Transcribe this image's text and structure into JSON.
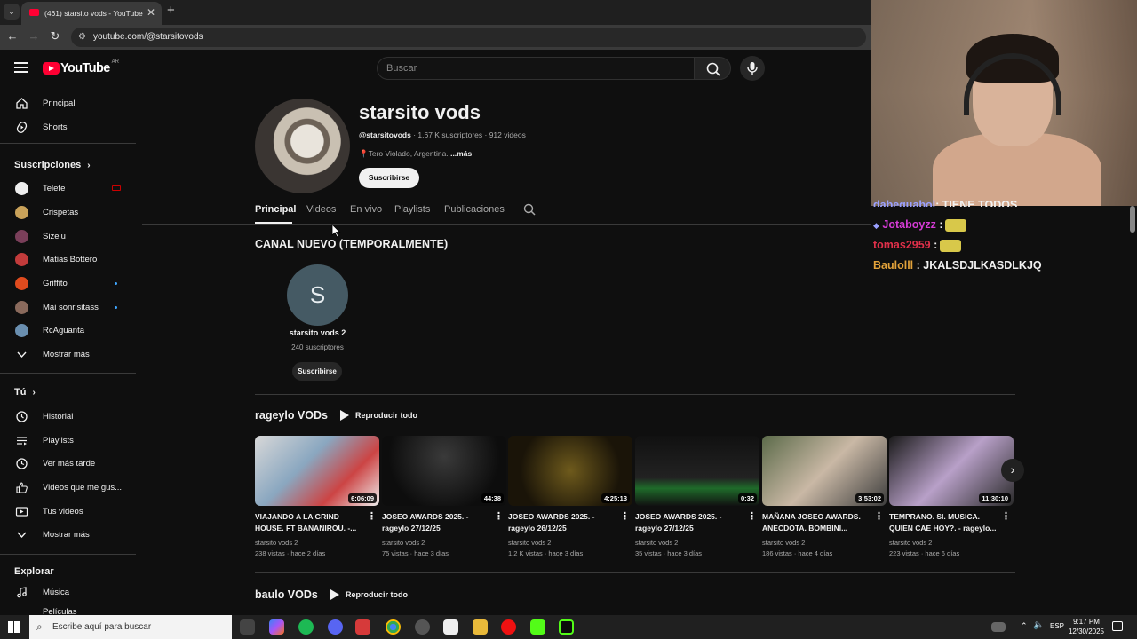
{
  "browser": {
    "tab_count_title": "(461) starsito vods - YouTube",
    "url": "youtube.com/@starsitovods"
  },
  "masthead": {
    "country": "AR",
    "logo_text": "YouTube",
    "search_placeholder": "Buscar"
  },
  "sidebar": {
    "main": [
      {
        "label": "Principal",
        "icon": "home-icon"
      },
      {
        "label": "Shorts",
        "icon": "shorts-icon"
      }
    ],
    "subs_title": "Suscripciones",
    "subs": [
      {
        "label": "Telefe",
        "color": "#1a8f3c",
        "live": true
      },
      {
        "label": "Crispetas",
        "color": "#c9a25a",
        "dot": false
      },
      {
        "label": "Sizelu",
        "color": "#7a3f5a",
        "dot": false
      },
      {
        "label": "Matias Bottero",
        "color": "#c23b3b",
        "dot": false
      },
      {
        "label": "Griffito",
        "color": "#e04b1e",
        "dot": true
      },
      {
        "label": "Mai sonrisitass",
        "color": "#8a6a5c",
        "dot": true
      },
      {
        "label": "RcAguanta",
        "color": "#6a8fb0",
        "dot": false
      }
    ],
    "show_more": "Mostrar más",
    "you_title": "Tú",
    "you": [
      {
        "label": "Historial",
        "icon": "history-icon"
      },
      {
        "label": "Playlists",
        "icon": "playlists-icon"
      },
      {
        "label": "Ver más tarde",
        "icon": "watch-later-icon"
      },
      {
        "label": "Videos que me gus...",
        "icon": "like-icon"
      },
      {
        "label": "Tus videos",
        "icon": "your-videos-icon"
      }
    ],
    "show_more2": "Mostrar más",
    "explore_title": "Explorar",
    "explore": [
      {
        "label": "Música",
        "icon": "music-icon"
      },
      {
        "label": "Películas",
        "icon": "movies-icon"
      }
    ]
  },
  "channel": {
    "name": "starsito vods",
    "handle": "@starsitovods",
    "meta": " · 1.67 K suscriptores · 912 videos",
    "location": "Tero Violado, Argentina.",
    "more": "...más",
    "subscribe": "Suscribirse",
    "tabs": [
      "Principal",
      "Videos",
      "En vivo",
      "Playlists",
      "Publicaciones"
    ]
  },
  "featured": {
    "title": "CANAL NUEVO (TEMPORALMENTE)",
    "initial": "S",
    "name": "starsito vods 2",
    "subs": "240 suscriptores",
    "subscribe": "Suscribirse"
  },
  "shelf1": {
    "title": "rageylo VODs",
    "play_all": "Reproducir todo",
    "videos": [
      {
        "title": "VIAJANDO A LA GRIND HOUSE. FT BANANIROU. -...",
        "duration": "6:06:09",
        "channel": "starsito vods 2",
        "stats": "238 vistas · hace 2 días",
        "bg": "linear-gradient(135deg,#d8d8d8,#8aa7c0 40%,#c44 70%,#eee)"
      },
      {
        "title": "JOSEO AWARDS 2025. - rageylo 27/12/25",
        "duration": "44:38",
        "channel": "starsito vods 2",
        "stats": "75 vistas · hace 3 días",
        "bg": "radial-gradient(circle at 50% 30%,#3a3a3a,#0d0d0d 70%)"
      },
      {
        "title": "JOSEO AWARDS 2025. - rageylo 26/12/25",
        "duration": "4:25:13",
        "channel": "starsito vods 2",
        "stats": "1.2 K vistas · hace 3 días",
        "bg": "radial-gradient(circle at 50% 50%,#6e5a1c,#1a1408 70%)"
      },
      {
        "title": "JOSEO AWARDS 2025. - rageylo 27/12/25",
        "duration": "0:32",
        "channel": "starsito vods 2",
        "stats": "35 vistas · hace 3 días",
        "bg": "linear-gradient(180deg,#111 0%,#222 60%,#1f6b2a 75%,#111 100%)"
      },
      {
        "title": "MAÑANA JOSEO AWARDS. ANECDOTA. BOMBINI...",
        "duration": "3:53:02",
        "channel": "starsito vods 2",
        "stats": "186 vistas · hace 4 días",
        "bg": "linear-gradient(135deg,#5c6b4a,#c9b8a5 50%,#3d3d3d)"
      },
      {
        "title": "TEMPRANO. SI. MUSICA. QUIEN CAE HOY?. - rageylo...",
        "duration": "11:30:10",
        "channel": "starsito vods 2",
        "stats": "223 vistas · hace 6 días",
        "bg": "linear-gradient(135deg,#1a1a1a,#b8a0c8 50%,#2a2a2a)"
      }
    ]
  },
  "shelf2": {
    "title": "baulo VODs",
    "play_all": "Reproducir todo"
  },
  "chat": [
    {
      "user": "dabeguabol",
      "msg": ": TIENE TODOS",
      "color": "#9aa0ff"
    },
    {
      "user": "Jotaboyzz",
      "msg": " :",
      "color": "#d43bd4"
    },
    {
      "user": "tomas2959",
      "msg": " :",
      "color": "#e0304a"
    },
    {
      "user": "Baulolll",
      "msg": " : JKALSDJLKASDLKJQ",
      "color": "#e2a23a"
    }
  ],
  "taskbar": {
    "search": "Escribe aquí para buscar",
    "lang": "ESP",
    "time": "9:17 PM",
    "date": "12/30/2025"
  }
}
